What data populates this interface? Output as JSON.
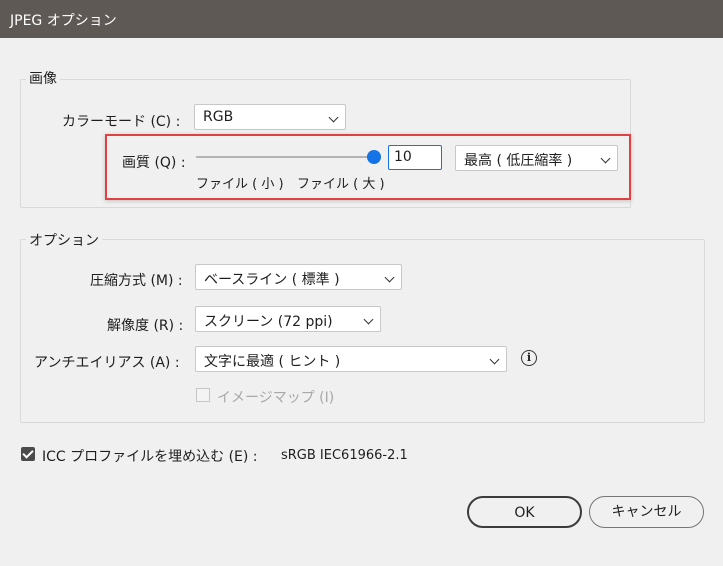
{
  "window": {
    "title": "JPEG オプション"
  },
  "image_section": {
    "legend": "画像",
    "color_mode": {
      "label": "カラーモード (C) :",
      "value": "RGB"
    },
    "quality": {
      "label": "画質 (Q) :",
      "slider_fraction": 1.0,
      "value": "10",
      "preset": "最高 ( 低圧縮率 )",
      "min_label": "ファイル ( 小 )",
      "max_label": "ファイル ( 大 )"
    }
  },
  "options_section": {
    "legend": "オプション",
    "compression": {
      "label": "圧縮方式 (M) :",
      "value": "ベースライン ( 標準 )"
    },
    "resolution": {
      "label": "解像度 (R) :",
      "value": "スクリーン (72 ppi)"
    },
    "antialias": {
      "label": "アンチエイリアス (A) :",
      "value": "文字に最適 ( ヒント )"
    },
    "imagemap": {
      "label": "イメージマップ (I)",
      "checked": false,
      "disabled": true
    }
  },
  "icc": {
    "label": "ICC プロファイルを埋め込む (E) :",
    "checked": true,
    "profile": "sRGB IEC61966-2.1"
  },
  "buttons": {
    "ok": "OK",
    "cancel": "キャンセル"
  },
  "colors": {
    "titlebar": "#5f5955",
    "accent": "#1473e6",
    "highlight": "#e04040"
  }
}
